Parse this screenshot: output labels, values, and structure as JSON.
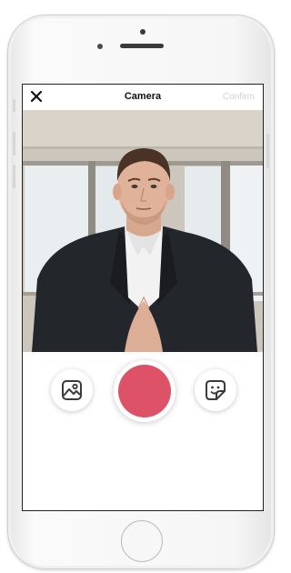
{
  "header": {
    "title": "Camera",
    "close_icon": "close-icon",
    "confirm_label": "Confirm",
    "confirm_state": "disabled"
  },
  "viewfinder": {
    "content": "live-camera-preview"
  },
  "controls": {
    "gallery_icon": "image-icon",
    "shutter_icon": "shutter-button",
    "sticker_icon": "sticker-icon"
  },
  "colors": {
    "shutter": "#de5268",
    "confirm_disabled": "#d0d0d0",
    "title": "#111111"
  }
}
